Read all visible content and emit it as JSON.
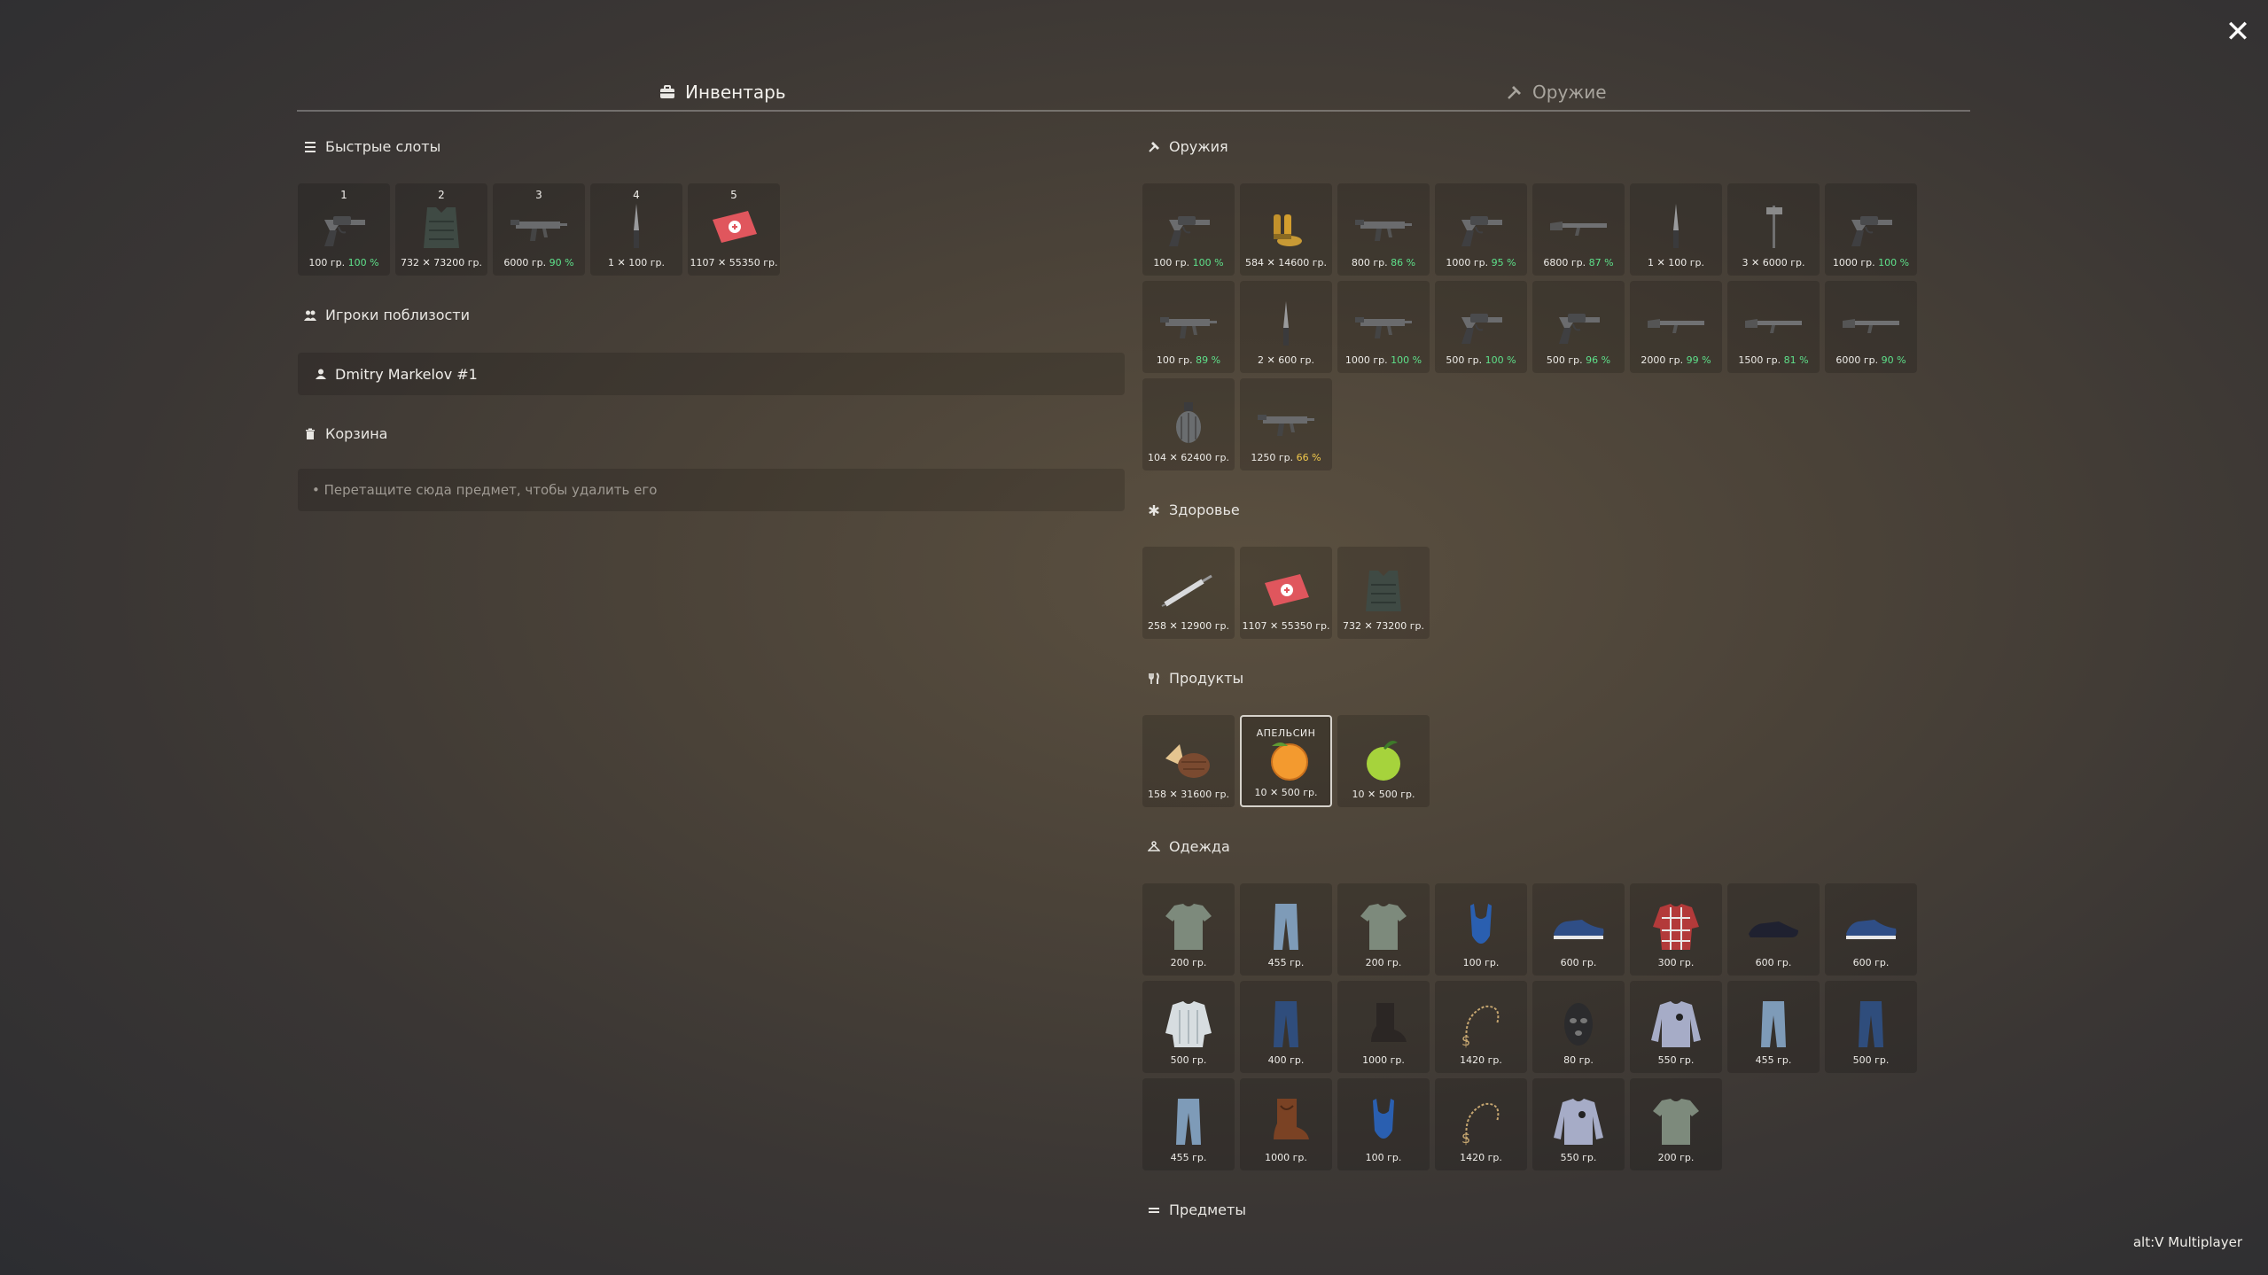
{
  "close_label": "✕",
  "tabs": [
    {
      "label": "Инвентарь",
      "active": true
    },
    {
      "label": "Оружие",
      "active": false
    }
  ],
  "quick_slots": {
    "title": "Быстрые слоты",
    "items": [
      {
        "num": "1",
        "icon": "revolver",
        "caption": "100 гр.",
        "pct": "100 %",
        "pct_color": "g"
      },
      {
        "num": "2",
        "icon": "vest",
        "caption": "732 ✕ 73200 гр.",
        "pct": "",
        "pct_color": ""
      },
      {
        "num": "3",
        "icon": "smg",
        "caption": "6000 гр.",
        "pct": "90 %",
        "pct_color": "g"
      },
      {
        "num": "4",
        "icon": "knife",
        "caption": "1 ✕ 100 гр.",
        "pct": "",
        "pct_color": ""
      },
      {
        "num": "5",
        "icon": "medkit",
        "caption": "1107 ✕ 55350 гр.",
        "pct": "",
        "pct_color": ""
      }
    ]
  },
  "nearby_players": {
    "title": "Игроки поблизости",
    "players": [
      "Dmitry Markelov #1"
    ]
  },
  "trash": {
    "title": "Корзина",
    "hint": "• Перетащите сюда предмет, чтобы удалить его"
  },
  "weapons": {
    "title": "Оружия",
    "items": [
      {
        "icon": "revolver",
        "caption": "100 гр.",
        "pct": "100 %",
        "pct_color": "g"
      },
      {
        "icon": "ammo",
        "caption": "584 ✕ 14600 гр.",
        "pct": "",
        "pct_color": ""
      },
      {
        "icon": "smg",
        "caption": "800 гр.",
        "pct": "86 %",
        "pct_color": "g"
      },
      {
        "icon": "revolver",
        "caption": "1000 гр.",
        "pct": "95 %",
        "pct_color": "g"
      },
      {
        "icon": "rifle",
        "caption": "6800 гр.",
        "pct": "87 %",
        "pct_color": "g"
      },
      {
        "icon": "knife",
        "caption": "1 ✕ 100 гр.",
        "pct": "",
        "pct_color": ""
      },
      {
        "icon": "axe",
        "caption": "3 ✕ 6000 гр.",
        "pct": "",
        "pct_color": ""
      },
      {
        "icon": "revolver",
        "caption": "1000 гр.",
        "pct": "100 %",
        "pct_color": "g"
      },
      {
        "icon": "smg",
        "caption": "100 гр.",
        "pct": "89 %",
        "pct_color": "g"
      },
      {
        "icon": "knife",
        "caption": "2 ✕ 600 гр.",
        "pct": "",
        "pct_color": ""
      },
      {
        "icon": "smg",
        "caption": "1000 гр.",
        "pct": "100 %",
        "pct_color": "g"
      },
      {
        "icon": "revolver",
        "caption": "500 гр.",
        "pct": "100 %",
        "pct_color": "g"
      },
      {
        "icon": "revolver",
        "caption": "500 гр.",
        "pct": "96 %",
        "pct_color": "g"
      },
      {
        "icon": "rifle",
        "caption": "2000 гр.",
        "pct": "99 %",
        "pct_color": "g"
      },
      {
        "icon": "rifle",
        "caption": "1500 гр.",
        "pct": "81 %",
        "pct_color": "g"
      },
      {
        "icon": "rifle",
        "caption": "6000 гр.",
        "pct": "90 %",
        "pct_color": "g"
      },
      {
        "icon": "grenade",
        "caption": "104 ✕ 62400 гр.",
        "pct": "",
        "pct_color": ""
      },
      {
        "icon": "smg",
        "caption": "1250 гр.",
        "pct": "66 %",
        "pct_color": "y"
      }
    ]
  },
  "health": {
    "title": "Здоровье",
    "items": [
      {
        "icon": "syringe",
        "caption": "258 ✕ 12900 гр.",
        "pct": "",
        "pct_color": ""
      },
      {
        "icon": "medkit",
        "caption": "1107 ✕ 55350 гр.",
        "pct": "",
        "pct_color": ""
      },
      {
        "icon": "vest",
        "caption": "732 ✕ 73200 гр.",
        "pct": "",
        "pct_color": ""
      }
    ]
  },
  "food": {
    "title": "Продукты",
    "items": [
      {
        "icon": "nuts",
        "caption": "158 ✕ 31600 гр.",
        "pct": "",
        "pct_color": "",
        "name": ""
      },
      {
        "icon": "orange",
        "caption": "10 ✕ 500 гр.",
        "pct": "",
        "pct_color": "",
        "name": "АПЕЛЬСИН",
        "highlight": true
      },
      {
        "icon": "apple",
        "caption": "10 ✕ 500 гр.",
        "pct": "",
        "pct_color": "",
        "name": ""
      }
    ]
  },
  "clothes": {
    "title": "Одежда",
    "items": [
      {
        "icon": "tshirt",
        "caption": "200 гр."
      },
      {
        "icon": "jeans-light",
        "caption": "455 гр."
      },
      {
        "icon": "tshirt",
        "caption": "200 гр."
      },
      {
        "icon": "swimsuit",
        "caption": "100 гр."
      },
      {
        "icon": "sneaker",
        "caption": "600 гр."
      },
      {
        "icon": "plaid-shirt",
        "caption": "300 гр."
      },
      {
        "icon": "dress-shoe",
        "caption": "600 гр."
      },
      {
        "icon": "sneaker",
        "caption": "600 гр."
      },
      {
        "icon": "sweater",
        "caption": "500 гр."
      },
      {
        "icon": "jeans-dark",
        "caption": "400 гр."
      },
      {
        "icon": "boot",
        "caption": "1000 гр."
      },
      {
        "icon": "chain",
        "caption": "1420 гр."
      },
      {
        "icon": "balaclava",
        "caption": "80 гр."
      },
      {
        "icon": "longsleeve",
        "caption": "550 гр."
      },
      {
        "icon": "jeans-light",
        "caption": "455 гр."
      },
      {
        "icon": "jeans-dark",
        "caption": "500 гр."
      },
      {
        "icon": "jeans-light",
        "caption": "455 гр."
      },
      {
        "icon": "cowboy-boot",
        "caption": "1000 гр."
      },
      {
        "icon": "swimsuit",
        "caption": "100 гр."
      },
      {
        "icon": "chain",
        "caption": "1420 гр."
      },
      {
        "icon": "longsleeve",
        "caption": "550 гр."
      },
      {
        "icon": "tshirt",
        "caption": "200 гр."
      }
    ]
  },
  "misc": {
    "title": "Предметы"
  },
  "footer": "alt:V Multiplayer"
}
